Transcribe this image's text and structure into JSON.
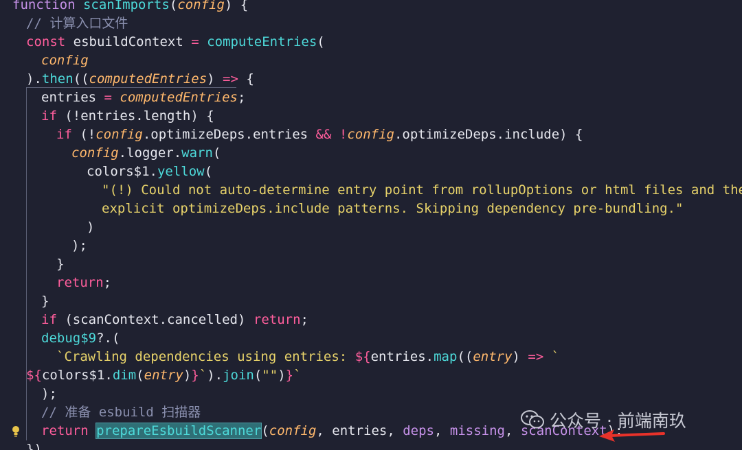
{
  "code": {
    "l1": {
      "kw": "function ",
      "fn": "scanImports",
      "p1": "(",
      "arg": "config",
      "p2": ") {"
    },
    "l2": {
      "cm": "// 计算入口文件"
    },
    "l3": {
      "kw": "const ",
      "var": "esbuildContext ",
      "op": "= ",
      "fn": "computeEntries",
      "p": "("
    },
    "l4": {
      "arg": "config"
    },
    "l5": {
      "p1": ").",
      "fn": "then",
      "p2": "((",
      "arg": "computedEntries",
      "p3": ") ",
      "op": "=>",
      "p4": " {"
    },
    "l6": {
      "var": "entries ",
      "op": "= ",
      "arg": "computedEntries",
      "p": ";"
    },
    "l7": {
      "kw": "if ",
      "p": "(!entries.length) {"
    },
    "l8": {
      "kw": "if ",
      "p1": "(!",
      "arg1": "config",
      "p2": ".optimizeDeps.entries ",
      "op": "&&",
      "p3": " !",
      "arg2": "config",
      "p4": ".optimizeDeps.include) {"
    },
    "l9": {
      "arg": "config",
      "p1": ".logger.",
      "fn": "warn",
      "p2": "("
    },
    "l10": {
      "p1": "colors$1.",
      "fn": "yellow",
      "p2": "("
    },
    "l11": {
      "str": "\"(!) Could not auto-determine entry point from rollupOptions or html files and there a"
    },
    "l12": {
      "str": "explicit optimizeDeps.include patterns. Skipping dependency pre-bundling.\""
    },
    "l13": {
      "p": ")"
    },
    "l14": {
      "p": ");"
    },
    "l15": {
      "p": "}"
    },
    "l16": {
      "kw": "return",
      "p": ";"
    },
    "l17": {
      "p": "}"
    },
    "l18": {
      "kw": "if ",
      "p1": "(scanContext.cancelled) ",
      "kw2": "return",
      "p2": ";"
    },
    "l19": {
      "fn": "debug$9",
      "p": "?.("
    },
    "l20": {
      "str1": "`Crawling dependencies using entries: ",
      "op": "${",
      "p1": "entries.",
      "fn": "map",
      "p2": "((",
      "arg": "entry",
      "p3": ") ",
      "op2": "=>",
      "str2": " `"
    },
    "l21": {
      "op": "${",
      "p1": "colors$1.",
      "fn": "dim",
      "p2": "(",
      "arg": "entry",
      "p3": ")",
      "op2": "}",
      "str": "`",
      "p4": ").",
      "fn2": "join",
      "p5": "(",
      "str2": "\"\"",
      "p6": ")",
      "op3": "}",
      "str3": "`"
    },
    "l22": {
      "p": ");"
    },
    "l23": {
      "cm": "// 准备 esbuild 扫描器"
    },
    "l24": {
      "kw": "return ",
      "fn": "prepareEsbuildScanner",
      "p1": "(",
      "arg": "config",
      "p2": ", entries, ",
      "v1": "deps",
      "p3": ", ",
      "v2": "missing",
      "p4": ", ",
      "v3": "scanContext",
      "p5": ");"
    },
    "l25": {
      "p": "})"
    }
  },
  "watermark": {
    "text": "公众号 · 前端南玖"
  },
  "icons": {
    "bulb": "lightbulb-icon",
    "wechat": "wechat-icon",
    "arrow": "red-arrow-icon"
  },
  "colors": {
    "background": "#1f2130",
    "keyword": "#c792ea",
    "function": "#4dd9d9",
    "param": "#ffb86c",
    "string": "#e8d36a",
    "comment": "#8a8fae",
    "arrow": "#e8322a",
    "highlight": "#2f6f76"
  }
}
